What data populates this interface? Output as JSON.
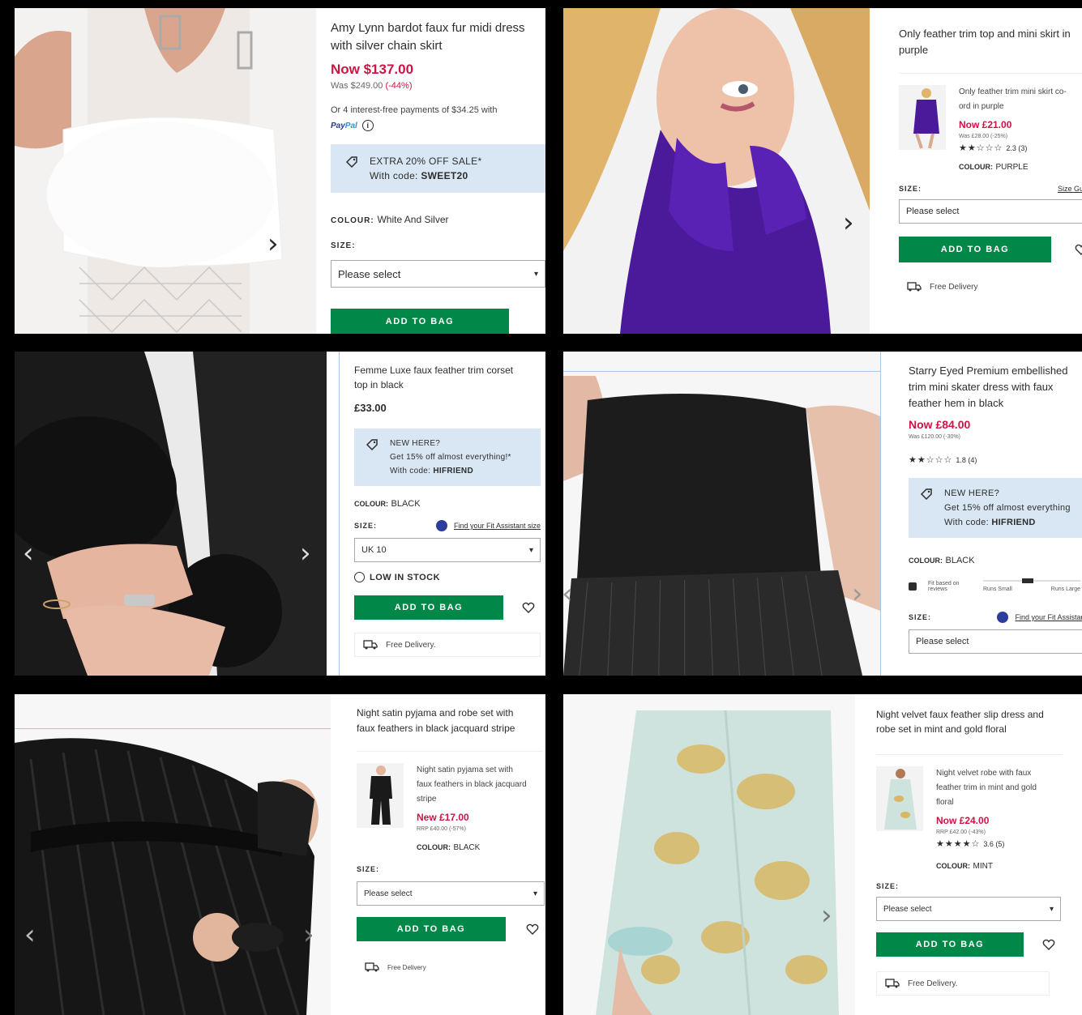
{
  "p1": {
    "title": "Amy Lynn bardot faux fur midi dress with silver chain skirt",
    "now": "Now $137.00",
    "was": "Was $249.00",
    "was_pct": "(-44%)",
    "payments": "Or 4 interest-free payments of $34.25 with",
    "paypal_a": "Pay",
    "paypal_b": "Pal",
    "info_icon": "i",
    "promo_line1": "EXTRA 20% OFF SALE*",
    "promo_with": "With code:",
    "promo_code": "SWEET20",
    "colour_label": "COLOUR:",
    "colour_value": "White And Silver",
    "size_label": "SIZE:",
    "size_placeholder": "Please select",
    "add_to_bag": "ADD TO BAG",
    "arrow": "›"
  },
  "p2": {
    "title": "Only feather trim top and mini skirt in purple",
    "sub_title": "Only feather trim mini skirt co-ord in purple",
    "sub_now": "Now £21.00",
    "sub_was": "Was £28.00 (-25%)",
    "sub_stars": "★★☆☆☆",
    "sub_rating": "2.3 (3)",
    "sub_colour_label": "COLOUR:",
    "sub_colour_value": "PURPLE",
    "size_label": "SIZE:",
    "size_guide": "Size Guide",
    "size_placeholder": "Please select",
    "add_to_bag": "ADD TO BAG",
    "delivery": "Free Delivery",
    "arrow": "›"
  },
  "p3": {
    "title": "Femme Luxe faux feather trim corset top in black",
    "price": "£33.00",
    "promo_line1": "NEW HERE?",
    "promo_line2": "Get 15% off almost everything!*",
    "promo_with": "With code:",
    "promo_code": "HIFRIEND",
    "colour_label": "COLOUR:",
    "colour_value": "BLACK",
    "size_label": "SIZE:",
    "fit_link": "Find your Fit Assistant size",
    "size_value": "UK 10",
    "low_stock": "LOW IN STOCK",
    "add_to_bag": "ADD TO BAG",
    "delivery": "Free Delivery.",
    "arrow_left": "‹",
    "arrow_right": "›"
  },
  "p4": {
    "title": "Starry Eyed Premium embellished trim mini skater dress with faux feather hem in black",
    "now": "Now £84.00",
    "was": "Was £120.00 (-30%)",
    "stars": "★★☆☆☆",
    "rating": "1.8 (4)",
    "promo_line1": "NEW HERE?",
    "promo_line2": "Get 15% off almost everything",
    "promo_with": "With code:",
    "promo_code": "HIFRIEND",
    "colour_label": "COLOUR:",
    "colour_value": "BLACK",
    "fit_text": "Fit based on reviews",
    "fit_small": "Runs Small",
    "fit_large": "Runs Large",
    "size_label": "SIZE:",
    "fit_link": "Find your Fit Assistant",
    "size_placeholder": "Please select",
    "arrow_left": "‹",
    "arrow_right": "›"
  },
  "p5": {
    "title": "Night satin pyjama and robe set with faux feathers in black jacquard stripe",
    "sub_title": "Night satin pyjama set with faux feathers in black jacquard stripe",
    "sub_now": "New £17.00",
    "sub_was": "RRP £40.00 (-57%)",
    "sub_colour_label": "COLOUR:",
    "sub_colour_value": "BLACK",
    "size_label": "SIZE:",
    "size_placeholder": "Please select",
    "add_to_bag": "ADD TO BAG",
    "delivery": "Free Delivery",
    "arrow_left": "‹",
    "arrow_right": "›"
  },
  "p6": {
    "title": "Night velvet faux feather slip dress and robe set in mint and gold floral",
    "sub_title": "Night velvet robe with faux feather trim in mint and gold floral",
    "sub_now": "Now £24.00",
    "sub_was": "RRP £42.00 (-43%)",
    "sub_stars": "★★★★☆",
    "sub_rating": "3.6 (5)",
    "sub_colour_label": "COLOUR:",
    "sub_colour_value": "MINT",
    "size_label": "SIZE:",
    "size_placeholder": "Please select",
    "add_to_bag": "ADD TO BAG",
    "delivery": "Free Delivery.",
    "arrow": "›"
  },
  "colors": {
    "sale_red": "#d01345",
    "asos_green": "#018849",
    "promo_blue": "#d8e7f3"
  },
  "icons": [
    "tag-icon",
    "heart-icon",
    "truck-icon",
    "chevron-down-icon",
    "chevron-right-icon",
    "chevron-left-icon",
    "info-icon",
    "clock-icon",
    "fit-assistant-icon",
    "paypal-logo"
  ]
}
